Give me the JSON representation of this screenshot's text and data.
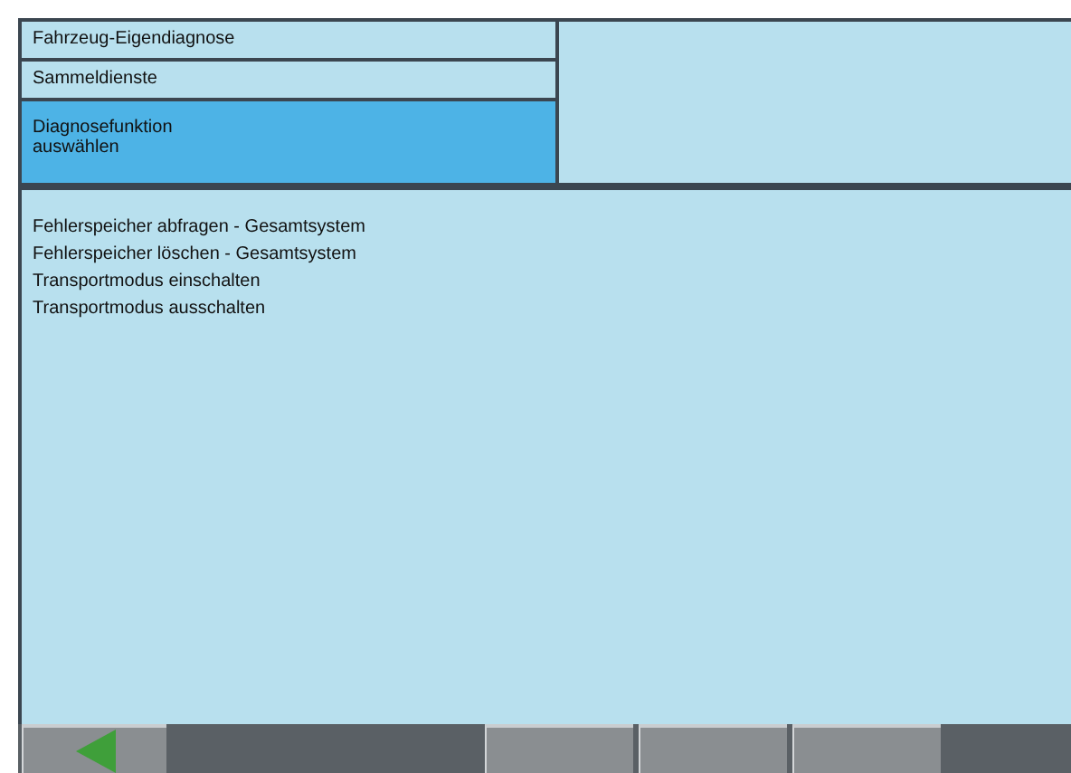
{
  "navigation": [
    {
      "label": "Fahrzeug-Eigendiagnose",
      "selected": false
    },
    {
      "label": "Sammeldienste",
      "selected": false
    },
    {
      "label": "Diagnosefunktion\nauswählen",
      "selected": true
    }
  ],
  "functions": [
    "Fehlerspeicher abfragen - Gesamtsystem",
    "Fehlerspeicher löschen - Gesamtsystem",
    "Transportmodus einschalten",
    "Transportmodus ausschalten"
  ],
  "toolbar": [
    {
      "kind": "back"
    },
    {
      "kind": "spacer"
    },
    {
      "kind": "blank"
    },
    {
      "kind": "blank"
    },
    {
      "kind": "blank"
    }
  ]
}
